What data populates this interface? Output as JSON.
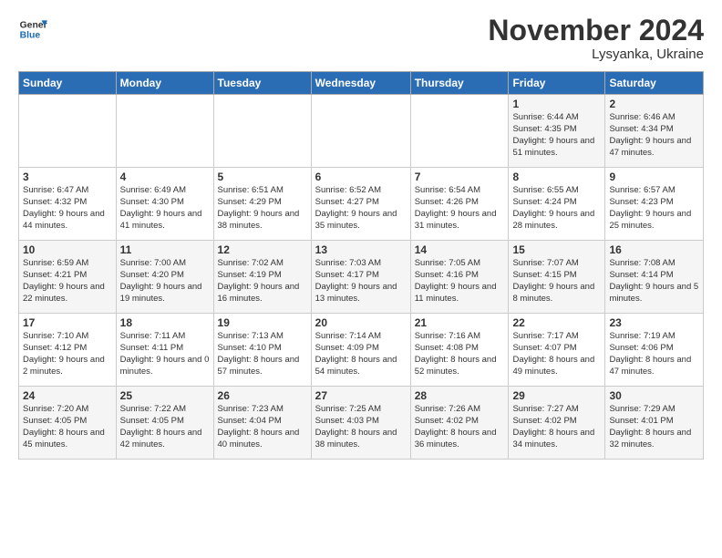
{
  "logo": {
    "line1": "General",
    "line2": "Blue"
  },
  "title": "November 2024",
  "subtitle": "Lysyanka, Ukraine",
  "days_header": [
    "Sunday",
    "Monday",
    "Tuesday",
    "Wednesday",
    "Thursday",
    "Friday",
    "Saturday"
  ],
  "weeks": [
    [
      {
        "day": "",
        "info": ""
      },
      {
        "day": "",
        "info": ""
      },
      {
        "day": "",
        "info": ""
      },
      {
        "day": "",
        "info": ""
      },
      {
        "day": "",
        "info": ""
      },
      {
        "day": "1",
        "info": "Sunrise: 6:44 AM\nSunset: 4:35 PM\nDaylight: 9 hours and 51 minutes."
      },
      {
        "day": "2",
        "info": "Sunrise: 6:46 AM\nSunset: 4:34 PM\nDaylight: 9 hours and 47 minutes."
      }
    ],
    [
      {
        "day": "3",
        "info": "Sunrise: 6:47 AM\nSunset: 4:32 PM\nDaylight: 9 hours and 44 minutes."
      },
      {
        "day": "4",
        "info": "Sunrise: 6:49 AM\nSunset: 4:30 PM\nDaylight: 9 hours and 41 minutes."
      },
      {
        "day": "5",
        "info": "Sunrise: 6:51 AM\nSunset: 4:29 PM\nDaylight: 9 hours and 38 minutes."
      },
      {
        "day": "6",
        "info": "Sunrise: 6:52 AM\nSunset: 4:27 PM\nDaylight: 9 hours and 35 minutes."
      },
      {
        "day": "7",
        "info": "Sunrise: 6:54 AM\nSunset: 4:26 PM\nDaylight: 9 hours and 31 minutes."
      },
      {
        "day": "8",
        "info": "Sunrise: 6:55 AM\nSunset: 4:24 PM\nDaylight: 9 hours and 28 minutes."
      },
      {
        "day": "9",
        "info": "Sunrise: 6:57 AM\nSunset: 4:23 PM\nDaylight: 9 hours and 25 minutes."
      }
    ],
    [
      {
        "day": "10",
        "info": "Sunrise: 6:59 AM\nSunset: 4:21 PM\nDaylight: 9 hours and 22 minutes."
      },
      {
        "day": "11",
        "info": "Sunrise: 7:00 AM\nSunset: 4:20 PM\nDaylight: 9 hours and 19 minutes."
      },
      {
        "day": "12",
        "info": "Sunrise: 7:02 AM\nSunset: 4:19 PM\nDaylight: 9 hours and 16 minutes."
      },
      {
        "day": "13",
        "info": "Sunrise: 7:03 AM\nSunset: 4:17 PM\nDaylight: 9 hours and 13 minutes."
      },
      {
        "day": "14",
        "info": "Sunrise: 7:05 AM\nSunset: 4:16 PM\nDaylight: 9 hours and 11 minutes."
      },
      {
        "day": "15",
        "info": "Sunrise: 7:07 AM\nSunset: 4:15 PM\nDaylight: 9 hours and 8 minutes."
      },
      {
        "day": "16",
        "info": "Sunrise: 7:08 AM\nSunset: 4:14 PM\nDaylight: 9 hours and 5 minutes."
      }
    ],
    [
      {
        "day": "17",
        "info": "Sunrise: 7:10 AM\nSunset: 4:12 PM\nDaylight: 9 hours and 2 minutes."
      },
      {
        "day": "18",
        "info": "Sunrise: 7:11 AM\nSunset: 4:11 PM\nDaylight: 9 hours and 0 minutes."
      },
      {
        "day": "19",
        "info": "Sunrise: 7:13 AM\nSunset: 4:10 PM\nDaylight: 8 hours and 57 minutes."
      },
      {
        "day": "20",
        "info": "Sunrise: 7:14 AM\nSunset: 4:09 PM\nDaylight: 8 hours and 54 minutes."
      },
      {
        "day": "21",
        "info": "Sunrise: 7:16 AM\nSunset: 4:08 PM\nDaylight: 8 hours and 52 minutes."
      },
      {
        "day": "22",
        "info": "Sunrise: 7:17 AM\nSunset: 4:07 PM\nDaylight: 8 hours and 49 minutes."
      },
      {
        "day": "23",
        "info": "Sunrise: 7:19 AM\nSunset: 4:06 PM\nDaylight: 8 hours and 47 minutes."
      }
    ],
    [
      {
        "day": "24",
        "info": "Sunrise: 7:20 AM\nSunset: 4:05 PM\nDaylight: 8 hours and 45 minutes."
      },
      {
        "day": "25",
        "info": "Sunrise: 7:22 AM\nSunset: 4:05 PM\nDaylight: 8 hours and 42 minutes."
      },
      {
        "day": "26",
        "info": "Sunrise: 7:23 AM\nSunset: 4:04 PM\nDaylight: 8 hours and 40 minutes."
      },
      {
        "day": "27",
        "info": "Sunrise: 7:25 AM\nSunset: 4:03 PM\nDaylight: 8 hours and 38 minutes."
      },
      {
        "day": "28",
        "info": "Sunrise: 7:26 AM\nSunset: 4:02 PM\nDaylight: 8 hours and 36 minutes."
      },
      {
        "day": "29",
        "info": "Sunrise: 7:27 AM\nSunset: 4:02 PM\nDaylight: 8 hours and 34 minutes."
      },
      {
        "day": "30",
        "info": "Sunrise: 7:29 AM\nSunset: 4:01 PM\nDaylight: 8 hours and 32 minutes."
      }
    ]
  ]
}
